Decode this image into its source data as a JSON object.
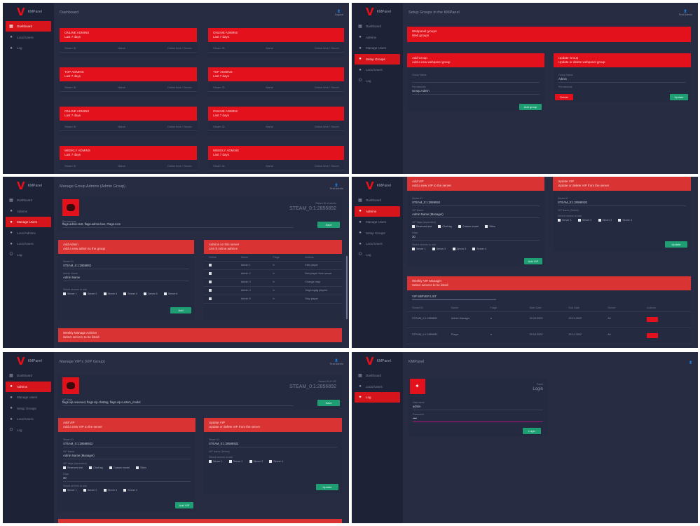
{
  "brand": {
    "name": "KMPanel",
    "color": "#e3111c"
  },
  "icons": {
    "dashboard": "dashboard-icon",
    "users": "users-icon",
    "user": "user-icon",
    "logout": "power-icon",
    "login": "key-icon"
  },
  "nav": {
    "dashboard": "Dashboard",
    "local_users": "Local Users",
    "log": "Log",
    "admins": "Admins",
    "manage_users": "Manage Users",
    "setup_groups": "Setup Groups",
    "local_admins": "Local Admins",
    "logout": "Logout",
    "login": "Login"
  },
  "user": {
    "name": "Test Admin",
    "role": "Logout"
  },
  "panel1": {
    "title": "Dashboard",
    "cards": [
      {
        "title": "ONLINE ADMINS",
        "sub": "Last 7 days",
        "cols": [
          "Steam ID",
          "Name",
          "Online time / Server"
        ]
      },
      {
        "title": "ONLINE ADMINS",
        "sub": "Last 7 days",
        "cols": [
          "Steam ID",
          "Name",
          "Online time / Server"
        ]
      },
      {
        "title": "TOP ADMINS",
        "sub": "Last 7 days",
        "cols": [
          "Steam ID",
          "Name",
          "Online time / Server"
        ]
      },
      {
        "title": "TOP ADMINS",
        "sub": "Last 7 days",
        "cols": [
          "Steam ID",
          "Name",
          "Online time / Server"
        ]
      },
      {
        "title": "ONLINE ADMINS",
        "sub": "Last 7 days",
        "cols": [
          "Steam ID",
          "Name",
          "Online time / Server"
        ]
      },
      {
        "title": "ONLINE ADMINS",
        "sub": "Last 7 days",
        "cols": [
          "Steam ID",
          "Name",
          "Online time / Server"
        ]
      },
      {
        "title": "WEEKLY ADMINS",
        "sub": "Last 7 days",
        "cols": [
          "Steam ID",
          "Name",
          "Online time / Server"
        ]
      },
      {
        "title": "WEEKLY ADMINS",
        "sub": "Last 7 days",
        "cols": [
          "Steam ID",
          "Name",
          "Online time / Server"
        ]
      }
    ]
  },
  "panel2": {
    "title": "Setup Groups in the KMPanel",
    "banner": {
      "title": "Webpanel groups",
      "sub": "Web groups"
    },
    "add": {
      "title": "Add Group",
      "sub": "Add a new webpanel group",
      "f1": "Group Name",
      "f2": "Permissions",
      "f2v": "Group.Admin",
      "btn": "Add group"
    },
    "update": {
      "title": "Update Group",
      "sub": "Update or delete webpanel group",
      "f1": "Group Name",
      "f1v": "Admin",
      "f2": "Permissions",
      "btn_del": "Delete",
      "btn_upd": "Update"
    }
  },
  "panel3": {
    "title": "Manage Group Admins (Admin Group)",
    "steam_label": "Steam ID of admin",
    "steam_id": "STEAM_0:1:2856892",
    "perm_label": "Permissions",
    "perm_value": "flags.admin.test, flags.admin.ban, Flags.rcon",
    "save": "Save",
    "add": {
      "title": "Add Admin",
      "sub": "Add a new admin to the group",
      "f1": "Steam ID",
      "f1v": "STEAM_0:1:2856892",
      "f2": "Admin Name",
      "f2v": "Admin Name",
      "groups": "Select servers to add",
      "servers": [
        "Server 1",
        "Server 2",
        "Server 3",
        "Server 4",
        "Server 5",
        "Server 6"
      ],
      "btn": "Add"
    },
    "online": {
      "title": "Admins on this server",
      "sub": "List of online admins",
      "cols": [
        "Online",
        "Name",
        "Flags",
        "Actions"
      ],
      "rows": [
        [
          "Admin 1",
          "b",
          "Kick player"
        ],
        [
          "Admin 2",
          "b",
          "Ban player from server"
        ],
        [
          "Admin 3",
          "b",
          "Change map"
        ],
        [
          "Admin 4",
          "b",
          "Gag/ungag players"
        ],
        [
          "Admin 5",
          "b",
          "Slay player"
        ]
      ]
    },
    "history": {
      "title": "Weekly Manage Admins",
      "sub": "Select servers to be listed"
    }
  },
  "panel4": {
    "add": {
      "title": "Add VIP",
      "sub": "Add a new VIP to the server",
      "f1": "Steam ID",
      "f1v": "STEAM_0:1:2856892",
      "f2": "VIP Name",
      "f2v": "Admin Name (Manager)",
      "flags_label": "VIP flags (separated)",
      "flags": [
        "Reserved slot",
        "Chat tag",
        "Custom model",
        "Skins"
      ],
      "days_label": "Days",
      "days": "30",
      "servers_label": "Select servers to add",
      "servers": [
        "Server 1",
        "Server 2",
        "Server 3",
        "Server 4",
        "Server 5",
        "Server 6"
      ],
      "btn": "Add VIP"
    },
    "update": {
      "title": "Update VIP",
      "sub": "Update or delete VIP from the server",
      "f1": "Steam ID",
      "f1v": "STEAM_0:1:28568922",
      "f2": "VIP Name (Select)",
      "servers_label": "Select servers to add",
      "servers": [
        "Server 1",
        "Server 2",
        "Server 3",
        "Server 4",
        "Server 5",
        "Server 6"
      ],
      "btn": "Update"
    },
    "list": {
      "title": "Weekly VIP Manager",
      "sub": "Select servers to be listed",
      "search_label": "VIP SERVER LIST",
      "cols": [
        "Steam ID",
        "Name",
        "Flags",
        "Start Date",
        "End Date",
        "Server",
        "Actions"
      ],
      "rows": [
        [
          "STEAM_0:1:2856892",
          "Admin Manager",
          "a",
          "20.10.2022",
          "20.11.2022",
          "All"
        ],
        [
          "STEAM_0:1:2856893",
          "Player",
          "a",
          "20.10.2022",
          "20.11.2022",
          "All"
        ]
      ]
    }
  },
  "panel5": {
    "title": "Manage VIP's (VIP Group)",
    "steam_label": "Steam ID of VIP",
    "steam_id": "STEAM_0:1:2856892",
    "perm_label": "VIP flags",
    "perm_value": "flags.vip.reserved, flags.vip.chattag, flags.vip.custom_model",
    "save": "Save",
    "add": {
      "title": "Add VIP",
      "sub": "Add a new VIP to the server",
      "f1": "Steam ID",
      "f1v": "STEAM_0:1:28568922",
      "f2": "VIP Name",
      "f2v": "Admin Name (Manager)",
      "flags_label": "VIP flags (separated)",
      "flags": [
        "Reserved slot",
        "Chat tag",
        "Custom model",
        "Skins",
        "Immunity"
      ],
      "days_label": "Days",
      "days": "30",
      "servers_label": "Select servers to add",
      "servers": [
        "Server 1",
        "Server 2",
        "Server 3",
        "Server 4",
        "Server 5"
      ],
      "btn": "Add VIP"
    },
    "update": {
      "title": "Update VIP",
      "sub": "Update or delete VIP from the server",
      "f1": "Steam ID",
      "f1v": "STEAM_0:1:28568922",
      "f2": "VIP Name (Select)",
      "servers_label": "Select servers to add",
      "servers": [
        "Server 1",
        "Server 2",
        "Server 3",
        "Server 4",
        "Server 5",
        "Server 6"
      ],
      "btn": "Update"
    }
  },
  "panel6": {
    "title": "KMPanel",
    "login_title": "Login",
    "login_sub": "Panel",
    "f1": "Username",
    "f1v": "admin",
    "f2": "Password",
    "f2v": "••••",
    "btn": "Login"
  }
}
